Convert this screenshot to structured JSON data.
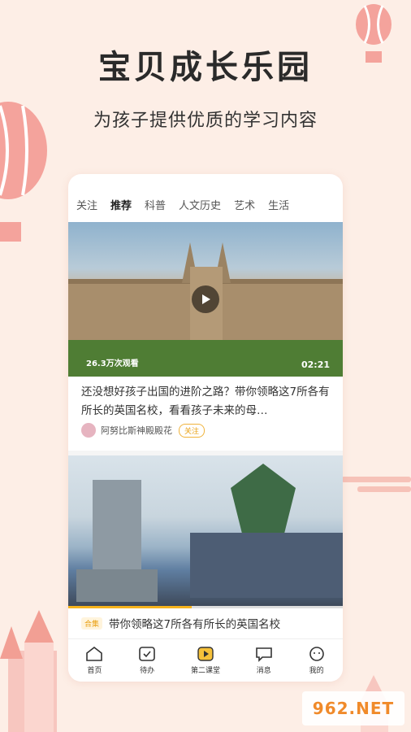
{
  "header": {
    "title": "宝贝成长乐园",
    "subtitle": "为孩子提供优质的学习内容"
  },
  "tabs": [
    {
      "label": "关注"
    },
    {
      "label": "推荐"
    },
    {
      "label": "科普"
    },
    {
      "label": "人文历史"
    },
    {
      "label": "艺术"
    },
    {
      "label": "生活"
    }
  ],
  "feed": {
    "video1": {
      "views": "26.3万次观看",
      "duration": "02:21",
      "description": "还没想好孩子出国的进阶之路？带你领略这7所各有所长的英国名校，看看孩子未来的母…",
      "author": "阿努比斯神殿殿花",
      "follow_label": "关注"
    },
    "video2": {
      "progress": 0.45,
      "collection_tag": "合集",
      "title": "带你领略这7所各有所长的英国名校"
    }
  },
  "tabbar": [
    {
      "label": "首页",
      "icon": "home-icon"
    },
    {
      "label": "待办",
      "icon": "todo-icon"
    },
    {
      "label": "第二课堂",
      "icon": "video-play-icon"
    },
    {
      "label": "消息",
      "icon": "message-icon"
    },
    {
      "label": "我的",
      "icon": "profile-icon"
    }
  ],
  "watermark": "962.NET",
  "colors": {
    "background": "#fdeee6",
    "accent": "#f6b31c",
    "balloon": "#f4a39c"
  }
}
